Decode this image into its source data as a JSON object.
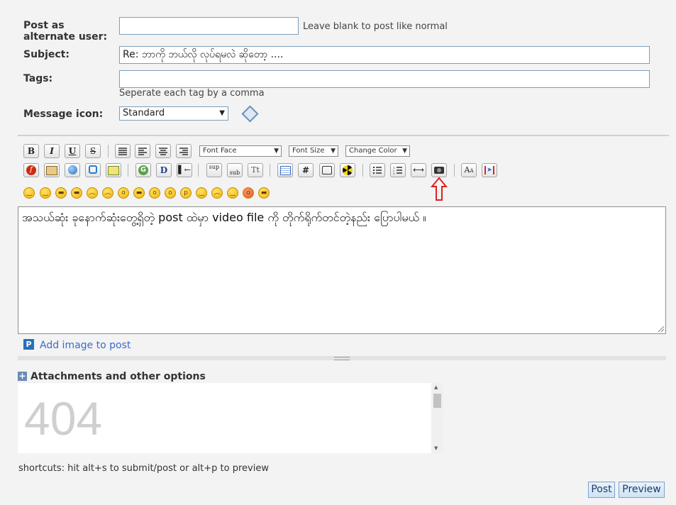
{
  "form": {
    "alt_user_label": "Post as alternate user:",
    "alt_user_value": "",
    "alt_user_hint": "Leave blank to post like normal",
    "subject_label": "Subject:",
    "subject_value": "Re: ဘာကို ဘယ်လို လုပ်ရမလဲ ဆိုတော့ ....",
    "tags_label": "Tags:",
    "tags_value": "",
    "tags_hint": "Seperate each tag by a comma",
    "icon_label": "Message icon:",
    "icon_value": "Standard"
  },
  "toolbar": {
    "format_buttons": [
      {
        "name": "bold-button",
        "text": "B"
      },
      {
        "name": "italic-button",
        "text": "I"
      },
      {
        "name": "underline-button",
        "text": "U"
      },
      {
        "name": "strike-button",
        "text": "S"
      }
    ],
    "font_face": "Font Face",
    "font_size": "Font Size",
    "change_color": "Change Color",
    "row2_text_buttons": {
      "google": "G",
      "dictionary": "D",
      "sup": "sup",
      "sub": "sub",
      "teletype": "Tt",
      "hash": "#"
    }
  },
  "editor": {
    "content": "အသယ်ဆုံး ခုနောက်ဆုံးတွေ့ရှိတဲ့ post ထဲမှာ video file ကို တိုက်ရိုက်တင်တဲ့နည်း ပြောပါမယ် ။"
  },
  "add_image_link": "Add image to post",
  "attachments": {
    "title": "Attachments and other options",
    "frame_text": "404"
  },
  "shortcuts": "shortcuts: hit alt+s to submit/post or alt+p to preview",
  "buttons": {
    "post": "Post",
    "preview": "Preview"
  },
  "colors": {
    "arrow_annotation": "#e02020",
    "link": "#3a6cc8",
    "accent": "#2a6ebb"
  }
}
